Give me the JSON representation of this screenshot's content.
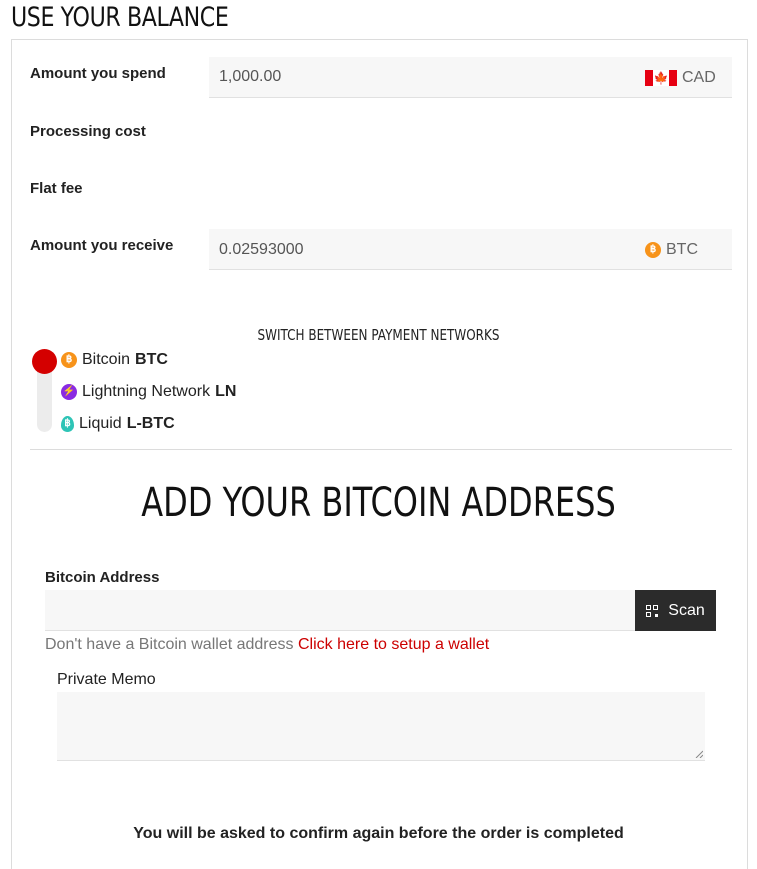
{
  "page": {
    "title": "USE YOUR BALANCE"
  },
  "spend": {
    "label": "Amount you spend",
    "value": "1,000.00",
    "currency": "CAD",
    "currency_icon": "canada-flag-icon"
  },
  "processing": {
    "label": "Processing cost"
  },
  "flat_fee": {
    "label": "Flat fee"
  },
  "receive": {
    "label": "Amount you receive",
    "value": "0.02593000",
    "currency": "BTC",
    "currency_icon": "bitcoin-icon"
  },
  "networks": {
    "title": "SWITCH BETWEEN PAYMENT NETWORKS",
    "selected": "Bitcoin",
    "items": [
      {
        "name": "Bitcoin",
        "code": "BTC",
        "icon": "bitcoin-icon",
        "color": "#f7931a"
      },
      {
        "name": "Lightning Network",
        "code": "LN",
        "icon": "lightning-icon",
        "color": "#8a2be2"
      },
      {
        "name": "Liquid",
        "code": "L-BTC",
        "icon": "liquid-icon",
        "color": "#2ec4b6"
      }
    ]
  },
  "address": {
    "heading": "ADD YOUR BITCOIN ADDRESS",
    "label": "Bitcoin Address",
    "value": "",
    "scan_label": "Scan",
    "hint_text": "Don't have a Bitcoin wallet address",
    "hint_link": "Click here to setup a wallet"
  },
  "memo": {
    "label": "Private Memo",
    "value": ""
  },
  "confirm_note": "You will be asked to confirm again before the order is completed",
  "colors": {
    "accent": "#d40000",
    "scan_button": "#2b2b2b",
    "link": "#cc0000",
    "field_bg": "#f7f7f7"
  }
}
